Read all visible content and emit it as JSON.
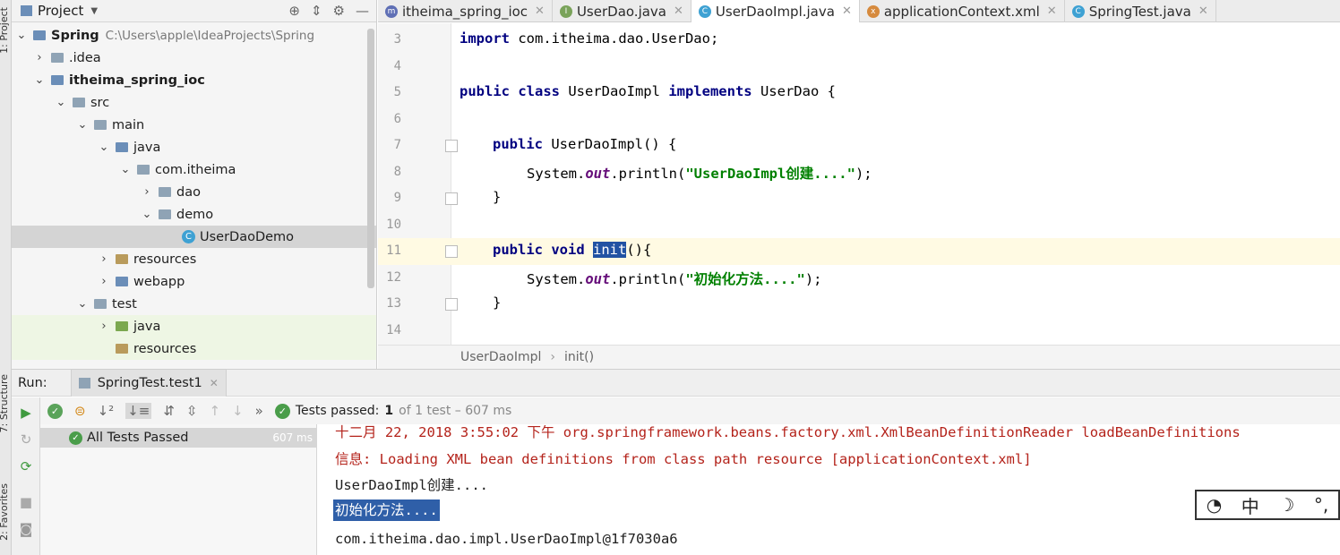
{
  "sidebar_strip": {
    "project_label": "1: Project",
    "structure_label": "7: Structure",
    "favorites_label": "2: Favorites"
  },
  "project": {
    "title": "Project",
    "tree": [
      {
        "label": "Spring",
        "path": "C:\\Users\\apple\\IdeaProjects\\Spring",
        "arrow": "⌄",
        "icon": "module"
      },
      {
        "label": ".idea",
        "arrow": "›",
        "icon": "folder"
      },
      {
        "label": "itheima_spring_ioc",
        "arrow": "⌄",
        "icon": "module"
      },
      {
        "label": "src",
        "arrow": "⌄",
        "icon": "folder"
      },
      {
        "label": "main",
        "arrow": "⌄",
        "icon": "folder"
      },
      {
        "label": "java",
        "arrow": "⌄",
        "icon": "source-folder"
      },
      {
        "label": "com.itheima",
        "arrow": "⌄",
        "icon": "package"
      },
      {
        "label": "dao",
        "arrow": "›",
        "icon": "package"
      },
      {
        "label": "demo",
        "arrow": "⌄",
        "icon": "package"
      },
      {
        "label": "UserDaoDemo",
        "arrow": "",
        "icon": "class"
      },
      {
        "label": "resources",
        "arrow": "›",
        "icon": "resources-folder"
      },
      {
        "label": "webapp",
        "arrow": "›",
        "icon": "web-folder"
      },
      {
        "label": "test",
        "arrow": "⌄",
        "icon": "folder"
      },
      {
        "label": "java",
        "arrow": "›",
        "icon": "test-source-folder"
      },
      {
        "label": "resources",
        "arrow": "",
        "icon": "test-resources-folder"
      }
    ]
  },
  "tabs": [
    {
      "label": "itheima_spring_ioc",
      "icon": "m",
      "color": "#5f6fb5"
    },
    {
      "label": "UserDao.java",
      "icon": "I",
      "color": "#7aa35a"
    },
    {
      "label": "UserDaoImpl.java",
      "icon": "C",
      "color": "#3ea1d3",
      "active": true
    },
    {
      "label": "applicationContext.xml",
      "icon": "x",
      "color": "#d68a3d"
    },
    {
      "label": "SpringTest.java",
      "icon": "C",
      "color": "#3ea1d3"
    }
  ],
  "editor": {
    "line_numbers": [
      "3",
      "4",
      "5",
      "6",
      "7",
      "8",
      "9",
      "10",
      "11",
      "12",
      "13",
      "14"
    ],
    "line3": {
      "kw": "import",
      "rest": " com.itheima.dao.UserDao;"
    },
    "line5": {
      "kw1": "public class",
      "name": " UserDaoImpl ",
      "kw2": "implements",
      "rest": " UserDao {"
    },
    "line7": {
      "kw": "public",
      "rest": " UserDaoImpl() {"
    },
    "line8": {
      "pre": "System.",
      "field": "out",
      "mid": ".println(",
      "str": "\"UserDaoImpl创建....\"",
      "end": ");"
    },
    "line9": "}",
    "line11": {
      "kw": "public void",
      "sel": "init",
      "rest": "(){"
    },
    "line12": {
      "pre": "System.",
      "field": "out",
      "mid": ".println(",
      "str": "\"初始化方法....\"",
      "end": ");"
    },
    "line13": "}"
  },
  "breadcrumb": {
    "class": "UserDaoImpl",
    "method": "init()"
  },
  "run": {
    "label": "Run:",
    "tab": "SpringTest.test1",
    "status_label": "Tests passed:",
    "passed_count": "1",
    "status_rest": "of 1 test – 607 ms",
    "tree_item": "All Tests Passed",
    "tree_time": "607 ms"
  },
  "console": {
    "lines": [
      "十二月 22, 2018 3:55:02 下午 org.springframework.beans.factory.xml.XmlBeanDefinitionReader loadBeanDefinitions",
      "信息: Loading XML bean definitions from class path resource [applicationContext.xml]",
      "UserDaoImpl创建....",
      "初始化方法....",
      "com.itheima.dao.impl.UserDaoImpl@1f7030a6"
    ]
  },
  "ime": {
    "mode": "中",
    "moon": "☽",
    "punct": "°,"
  }
}
